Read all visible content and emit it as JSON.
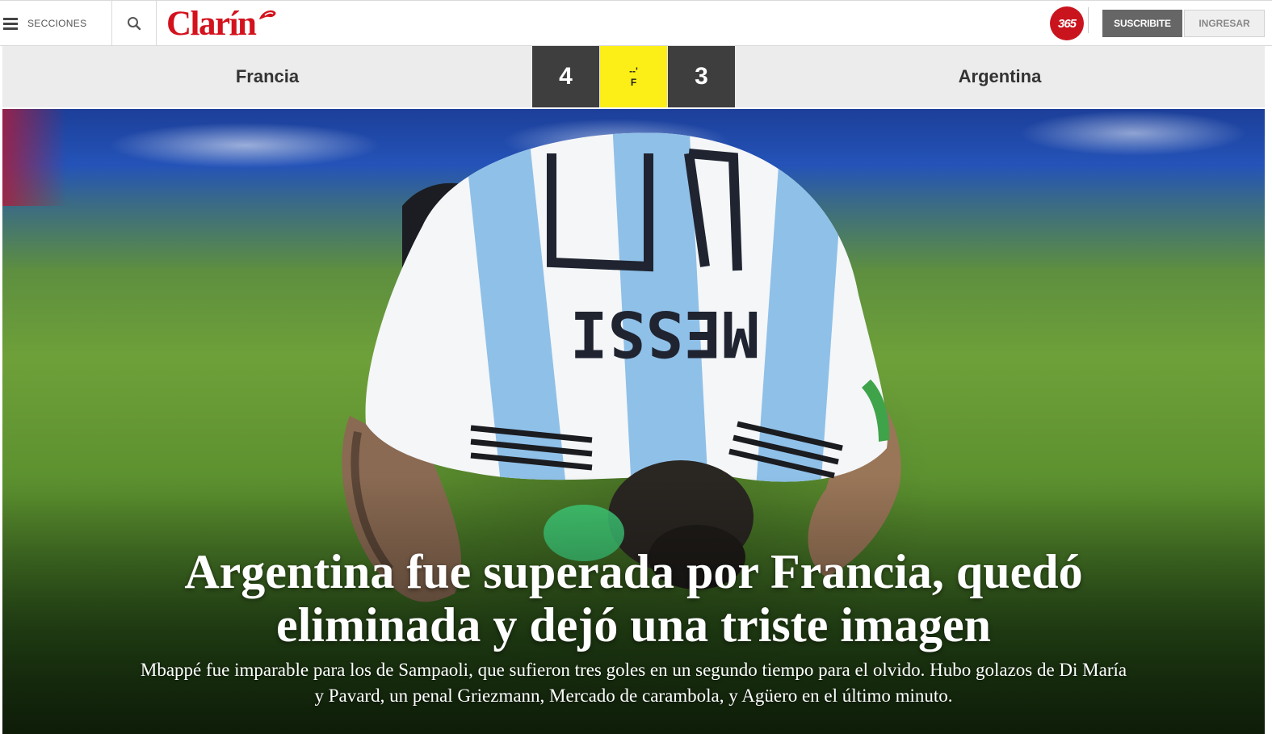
{
  "header": {
    "sections_label": "SECCIONES",
    "logo_text": "Clarín",
    "badge_text": "365",
    "subscribe_label": "SUSCRIBITE",
    "login_label": "INGRESAR",
    "icons": [
      "hamburger-icon",
      "search-icon"
    ]
  },
  "scoreboard": {
    "home_team": "Francia",
    "home_score": "4",
    "status_minute": "--'",
    "status_code": "F",
    "away_score": "3",
    "away_team": "Argentina"
  },
  "hero": {
    "headline": "Argentina fue superada por Francia, quedó eliminada y dejó una triste imagen",
    "summary": "Mbappé fue imparable para los de Sampaoli, que sufieron tres goles en un segundo tiempo para el olvido. Hubo golazos de Di María y Pavard, un penal Griezmann, Mercado de carambola, y Agüero en el último minuto.",
    "jersey_name": "MESSI",
    "jersey_number": "10"
  },
  "colors": {
    "brand_red": "#d3121d",
    "score_box": "#3e3e3e",
    "status_yellow": "#fcee17",
    "scorebar_bg": "#ececec"
  }
}
